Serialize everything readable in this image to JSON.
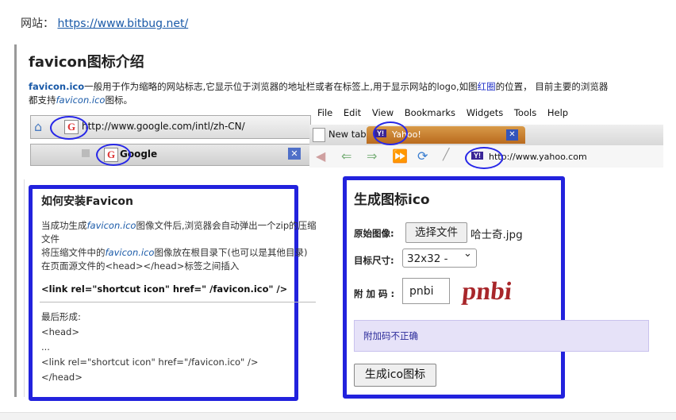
{
  "site": {
    "label": "网站：",
    "url": "https://www.bitbug.net/"
  },
  "page_title": "favicon图标介绍",
  "intro": {
    "term": "favicon.ico",
    "text1": "一般用于作为缩略的网站标志,它显示位于浏览器的地址栏或者在标签上,用于显示网站的logo,如图",
    "red_word": "红圈",
    "text2": "的位置，  目前主要的浏览器",
    "text3": "都支持",
    "term2": "favicon.ico",
    "text4": "图标。"
  },
  "illustration": {
    "url1": "http://www.google.com/intl/zh-CN/",
    "tab1": "Google",
    "menu": [
      "File",
      "Edit",
      "View",
      "Bookmarks",
      "Widgets",
      "Tools",
      "Help"
    ],
    "tab_new": "New tab",
    "tab_yahoo": "Yahoo!",
    "url2": "http://www.yahoo.com",
    "g_icon": "G",
    "y_icon": "Y!"
  },
  "left_panel": {
    "title": "如何安装Favicon",
    "line1a": "当成功生成",
    "line1_term": "favicon.ico",
    "line1b": "图像文件后,浏览器会自动弹出一个zip的压缩",
    "line2": "文件",
    "line3a": "将压缩文件中的",
    "line3_term": "favicon.ico",
    "line3b": "图像放在根目录下(也可以是其他目录)",
    "line4": "在页面源文件的<head></head>标签之间插入",
    "link_tag": "<link rel=\"shortcut icon\" href=\" /favicon.ico\" />",
    "final_label": "最后形成:",
    "code": [
      "<head>",
      "...",
      "<link rel=\"shortcut icon\" href=\"/favicon.ico\" />",
      "</head>"
    ]
  },
  "right_panel": {
    "title": "生成图标ico",
    "file_label": "原始图像:",
    "file_button": "选择文件",
    "file_name": "哈士奇.jpg",
    "size_label": "目标尺寸:",
    "size_value": "32x32 -",
    "code_label": "附加码:",
    "code_value": "pnbi",
    "captcha_text": "pnbi",
    "error_text": "附加码不正确",
    "generate_button": "生成ico图标"
  },
  "colors": {
    "highlight_border": "#2222dd",
    "link": "#1a5aa8",
    "error_bg": "#e6e2f8"
  }
}
